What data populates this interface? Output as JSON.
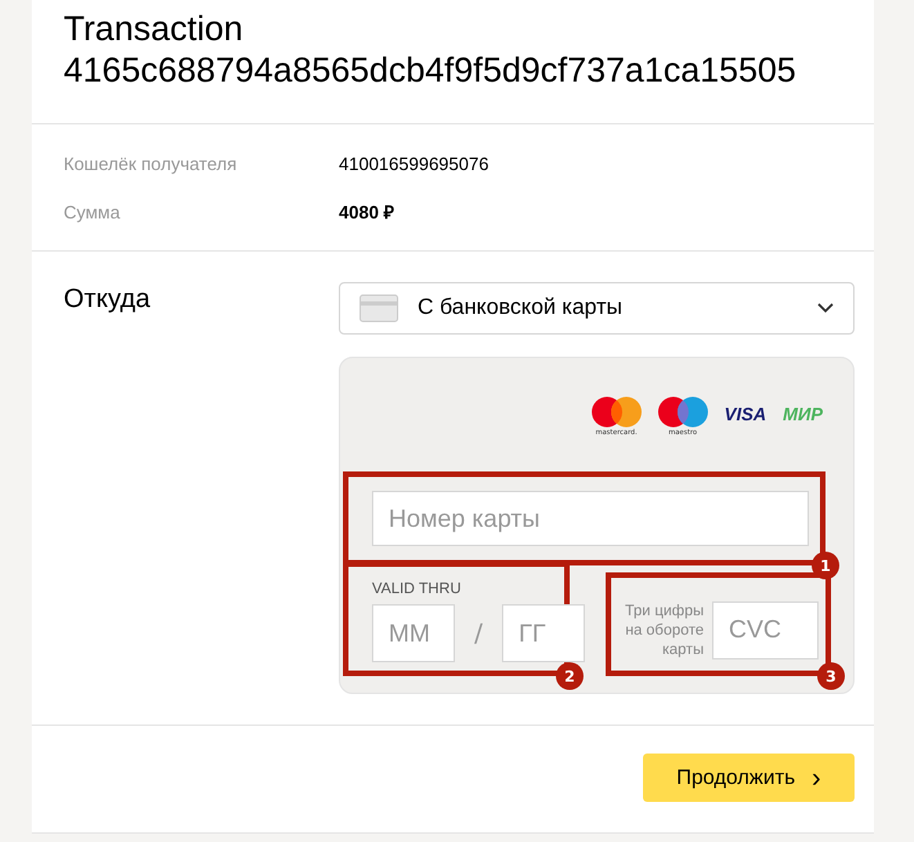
{
  "title": "Transaction 4165c688794a8565dcb4f9f5d9cf737a1ca15505",
  "details": [
    {
      "label": "Кошелёк получателя",
      "value": "410016599695076",
      "kind": "plain"
    },
    {
      "label": "Сумма",
      "value": "4080 ₽",
      "kind": "bold"
    }
  ],
  "source": {
    "label": "Откуда",
    "select": {
      "value": "С банковской карты"
    }
  },
  "card_form": {
    "logos": [
      {
        "kind": "mastercard",
        "caption": "mastercard."
      },
      {
        "kind": "maestro",
        "caption": "maestro"
      },
      {
        "kind": "visa",
        "caption": "VISA"
      },
      {
        "kind": "mir",
        "caption": "МИР"
      }
    ],
    "card_number": {
      "placeholder": "Номер карты",
      "badge": "1"
    },
    "expiry": {
      "label": "VALID THRU",
      "month": {
        "placeholder": "ММ"
      },
      "separator": "/",
      "year": {
        "placeholder": "ГГ"
      },
      "badge": "2"
    },
    "cvc": {
      "hint": "Три цифры на обороте карты",
      "placeholder": "CVC",
      "badge": "3"
    }
  },
  "submit": {
    "label": "Продолжить",
    "arrow": "›"
  }
}
